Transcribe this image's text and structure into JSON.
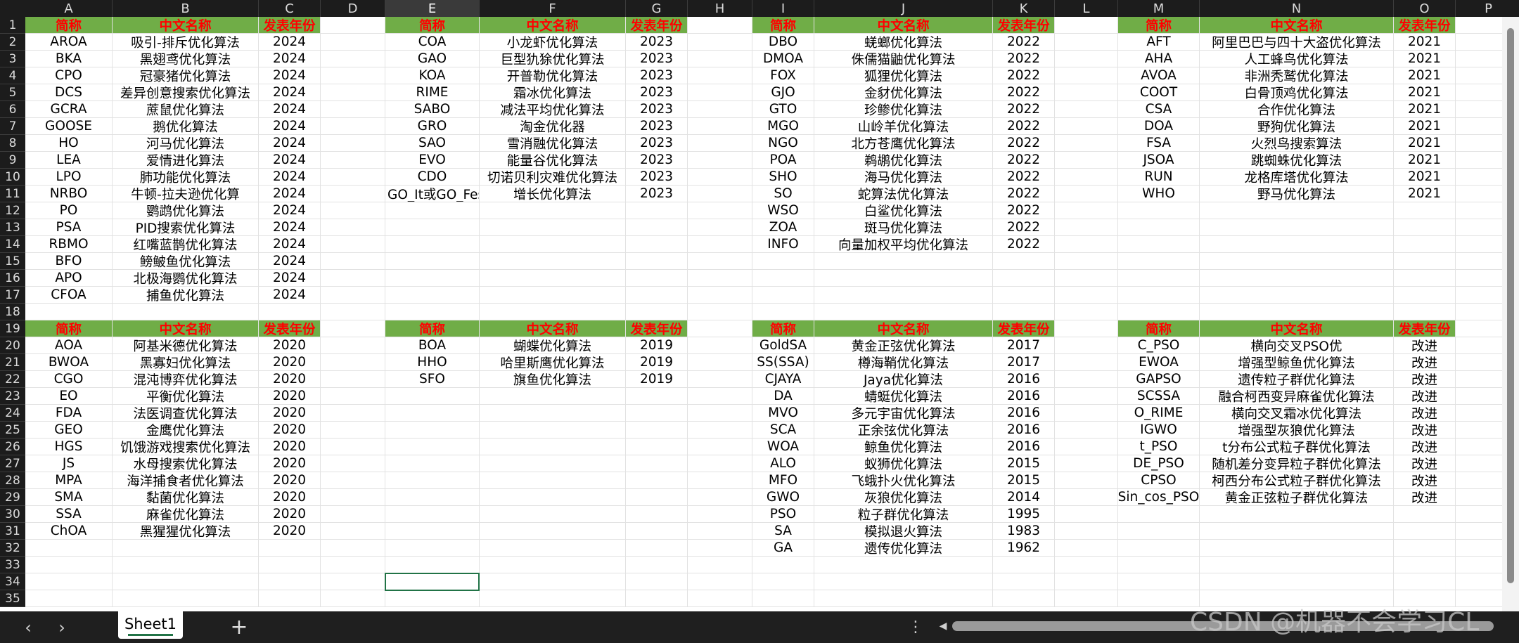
{
  "app": {
    "sheet_tab": "Sheet1",
    "watermark": "CSDN @机器不会学习CL",
    "add_sheet_glyph": "+",
    "more_glyph": "⋮",
    "prev_glyph": "‹",
    "next_glyph": "›"
  },
  "columns": [
    "A",
    "B",
    "C",
    "D",
    "E",
    "F",
    "G",
    "H",
    "I",
    "J",
    "K",
    "L",
    "M",
    "N",
    "O",
    "P"
  ],
  "selected_column": "E",
  "row_numbers": [
    "1",
    "2",
    "3",
    "4",
    "5",
    "6",
    "7",
    "8",
    "9",
    "10",
    "11",
    "12",
    "13",
    "14",
    "15",
    "16",
    "17",
    "18",
    "19",
    "20",
    "21",
    "22",
    "23",
    "24",
    "25",
    "26",
    "27",
    "28",
    "29",
    "30",
    "31",
    "32",
    "33",
    "34",
    "35"
  ],
  "colors": {
    "header_fill": "#70ad47",
    "header_text": "#ff0000",
    "selection": "#217346"
  },
  "header_labels": [
    "简称",
    "中文名称",
    "发表年份"
  ],
  "tables": [
    {
      "name": "block-2024",
      "rows": [
        [
          "AROA",
          "吸引-排斥优化算法",
          "2024"
        ],
        [
          "BKA",
          "黑翅鸢优化算法",
          "2024"
        ],
        [
          "CPO",
          "冠豪猪优化算法",
          "2024"
        ],
        [
          "DCS",
          "差异创意搜索优化算法",
          "2024"
        ],
        [
          "GCRA",
          "蔗鼠优化算法",
          "2024"
        ],
        [
          "GOOSE",
          "鹅优化算法",
          "2024"
        ],
        [
          "HO",
          "河马优化算法",
          "2024"
        ],
        [
          "LEA",
          "爱情进化算法",
          "2024"
        ],
        [
          "LPO",
          "肺功能优化算法",
          "2024"
        ],
        [
          "NRBO",
          "牛顿-拉夫逊优化算",
          "2024"
        ],
        [
          "PO",
          "鹦鹉优化算法",
          "2024"
        ],
        [
          "PSA",
          "PID搜索优化算法",
          "2024"
        ],
        [
          "RBMO",
          "红嘴蓝鹊优化算法",
          "2024"
        ],
        [
          "BFO",
          "鳑鲏鱼优化算法",
          "2024"
        ],
        [
          "APO",
          "北极海鹦优化算法",
          "2024"
        ],
        [
          "CFOA",
          "捕鱼优化算法",
          "2024"
        ]
      ]
    },
    {
      "name": "block-2023",
      "rows": [
        [
          "COA",
          "小龙虾优化算法",
          "2023"
        ],
        [
          "GAO",
          "巨型犰狳优化算法",
          "2023"
        ],
        [
          "KOA",
          "开普勒优化算法",
          "2023"
        ],
        [
          "RIME",
          "霜冰优化算法",
          "2023"
        ],
        [
          "SABO",
          "减法平均优化算法",
          "2023"
        ],
        [
          "GRO",
          "淘金优化器",
          "2023"
        ],
        [
          "SAO",
          "雪消融优化算法",
          "2023"
        ],
        [
          "EVO",
          "能量谷优化算法",
          "2023"
        ],
        [
          "CDO",
          "切诺贝利灾难优化算法",
          "2023"
        ],
        [
          "GO_It或GO_Fes",
          "增长优化算法",
          "2023"
        ]
      ]
    },
    {
      "name": "block-2022",
      "rows": [
        [
          "DBO",
          "蜣螂优化算法",
          "2022"
        ],
        [
          "DMOA",
          "侏儒猫鼬优化算法",
          "2022"
        ],
        [
          "FOX",
          "狐狸优化算法",
          "2022"
        ],
        [
          "GJO",
          "金豺优化算法",
          "2022"
        ],
        [
          "GTO",
          "珍鲹优化算法",
          "2022"
        ],
        [
          "MGO",
          "山岭羊优化算法",
          "2022"
        ],
        [
          "NGO",
          "北方苍鹰优化算法",
          "2022"
        ],
        [
          "POA",
          "鹈鹕优化算法",
          "2022"
        ],
        [
          "SHO",
          "海马优化算法",
          "2022"
        ],
        [
          "SO",
          "蛇算法优化算法",
          "2022"
        ],
        [
          "WSO",
          "白鲨优化算法",
          "2022"
        ],
        [
          "ZOA",
          "斑马优化算法",
          "2022"
        ],
        [
          "INFO",
          "向量加权平均优化算法",
          "2022"
        ]
      ]
    },
    {
      "name": "block-2021",
      "rows": [
        [
          "AFT",
          "阿里巴巴与四十大盗优化算法",
          "2021"
        ],
        [
          "AHA",
          "人工蜂鸟优化算法",
          "2021"
        ],
        [
          "AVOA",
          "非洲秃鹫优化算法",
          "2021"
        ],
        [
          "COOT",
          "白骨顶鸡优化算法",
          "2021"
        ],
        [
          "CSA",
          "合作优化算法",
          "2021"
        ],
        [
          "DOA",
          "野狗优化算法",
          "2021"
        ],
        [
          "FSA",
          "火烈鸟搜索算法",
          "2021"
        ],
        [
          "JSOA",
          "跳蜘蛛优化算法",
          "2021"
        ],
        [
          "RUN",
          "龙格库塔优化算法",
          "2021"
        ],
        [
          "WHO",
          "野马优化算法",
          "2021"
        ]
      ]
    },
    {
      "name": "block-2020",
      "rows": [
        [
          "AOA",
          "阿基米德优化算法",
          "2020"
        ],
        [
          "BWOA",
          "黑寡妇优化算法",
          "2020"
        ],
        [
          "CGO",
          "混沌博弈优化算法",
          "2020"
        ],
        [
          "EO",
          "平衡优化算法",
          "2020"
        ],
        [
          "FDA",
          "法医调查优化算法",
          "2020"
        ],
        [
          "GEO",
          "金鹰优化算法",
          "2020"
        ],
        [
          "HGS",
          "饥饿游戏搜索优化算法",
          "2020"
        ],
        [
          "JS",
          "水母搜索优化算法",
          "2020"
        ],
        [
          "MPA",
          "海洋捕食者优化算法",
          "2020"
        ],
        [
          "SMA",
          "黏菌优化算法",
          "2020"
        ],
        [
          "SSA",
          "麻雀优化算法",
          "2020"
        ],
        [
          "ChOA",
          "黑猩猩优化算法",
          "2020"
        ]
      ]
    },
    {
      "name": "block-2019",
      "rows": [
        [
          "BOA",
          "蝴蝶优化算法",
          "2019"
        ],
        [
          "HHO",
          "哈里斯鹰优化算法",
          "2019"
        ],
        [
          "SFO",
          "旗鱼优化算法",
          "2019"
        ]
      ]
    },
    {
      "name": "block-classic",
      "rows": [
        [
          "GoldSA",
          "黄金正弦优化算法",
          "2017"
        ],
        [
          "SS(SSA)",
          "樽海鞘优化算法",
          "2017"
        ],
        [
          "CJAYA",
          "Jaya优化算法",
          "2016"
        ],
        [
          "DA",
          "蜻蜓优化算法",
          "2016"
        ],
        [
          "MVO",
          "多元宇宙优化算法",
          "2016"
        ],
        [
          "SCA",
          "正余弦优化算法",
          "2016"
        ],
        [
          "WOA",
          "鲸鱼优化算法",
          "2016"
        ],
        [
          "ALO",
          "蚁狮优化算法",
          "2015"
        ],
        [
          "MFO",
          "飞蛾扑火优化算法",
          "2015"
        ],
        [
          "GWO",
          "灰狼优化算法",
          "2014"
        ],
        [
          "PSO",
          "粒子群优化算法",
          "1995"
        ],
        [
          "SA",
          "模拟退火算法",
          "1983"
        ],
        [
          "GA",
          "遗传优化算法",
          "1962"
        ]
      ]
    },
    {
      "name": "block-improved",
      "rows": [
        [
          "C_PSO",
          "横向交叉PSO优",
          "改进"
        ],
        [
          "EWOA",
          "增强型鲸鱼优化算法",
          "改进"
        ],
        [
          "GAPSO",
          "遗传粒子群优化算法",
          "改进"
        ],
        [
          "SCSSA",
          "融合柯西变异麻雀优化算法",
          "改进"
        ],
        [
          "O_RIME",
          "横向交叉霜冰优化算法",
          "改进"
        ],
        [
          "IGWO",
          "增强型灰狼优化算法",
          "改进"
        ],
        [
          "t_PSO",
          "t分布公式粒子群优化算法",
          "改进"
        ],
        [
          "DE_PSO",
          "随机差分变异粒子群优化算法",
          "改进"
        ],
        [
          "CPSO",
          "柯西分布公式粒子群优化算法",
          "改进"
        ],
        [
          "Sin_cos_PSO",
          "黄金正弦粒子群优化算法",
          "改进"
        ]
      ]
    }
  ]
}
